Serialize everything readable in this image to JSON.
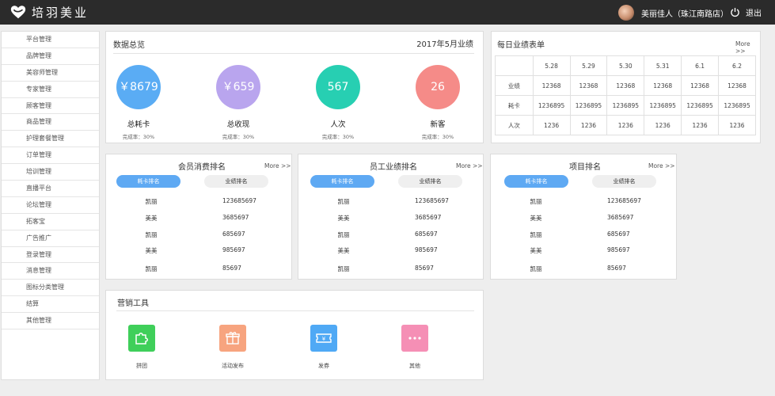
{
  "brand": {
    "name": "培羽美业"
  },
  "user": {
    "name": "美丽佳人（珠江南路店）",
    "logout_label": "退出"
  },
  "sidebar": {
    "items": [
      "平台管理",
      "品牌管理",
      "美容师管理",
      "专家管理",
      "顾客管理",
      "商品管理",
      "护理套餐管理",
      "订单管理",
      "培训管理",
      "直播平台",
      "论坛管理",
      "拓客宝",
      "广告推广",
      "登录管理",
      "消息管理",
      "图标分类管理",
      "结算",
      "其他管理"
    ]
  },
  "overview": {
    "title": "数据总览",
    "period": "2017年5月业绩",
    "stats": [
      {
        "value": "￥8679",
        "label": "总耗卡",
        "rate": "完成率：30%",
        "color": "#5aacf4"
      },
      {
        "value": "￥659",
        "label": "总收现",
        "rate": "完成率：30%",
        "color": "#b9a5ee"
      },
      {
        "value": "567",
        "label": "人次",
        "rate": "完成率：30%",
        "color": "#27cfb2"
      },
      {
        "value": "26",
        "label": "新客",
        "rate": "完成率：30%",
        "color": "#f58b88"
      }
    ]
  },
  "daily": {
    "title": "每日业绩表单",
    "more": "More >>",
    "dates": [
      "5.28",
      "5.29",
      "5.30",
      "5.31",
      "6.1",
      "6.2"
    ],
    "rows": [
      {
        "label": "业绩",
        "values": [
          "12368",
          "12368",
          "12368",
          "12368",
          "12368",
          "12368"
        ]
      },
      {
        "label": "耗卡",
        "values": [
          "1236895",
          "1236895",
          "1236895",
          "1236895",
          "1236895",
          "1236895"
        ]
      },
      {
        "label": "人次",
        "values": [
          "1236",
          "1236",
          "1236",
          "1236",
          "1236",
          "1236"
        ]
      }
    ]
  },
  "rankings": [
    {
      "title": "会员消费排名",
      "more": "More >>",
      "tab_active": "耗卡排名",
      "tab_inactive": "业绩排名",
      "rows": [
        [
          "凯丽",
          "123685697"
        ],
        [
          "美美",
          "3685697"
        ],
        [
          "凯丽",
          "685697"
        ],
        [
          "美美",
          "985697"
        ],
        [
          "凯丽",
          "85697"
        ]
      ]
    },
    {
      "title": "员工业绩排名",
      "more": "More >>",
      "tab_active": "耗卡排名",
      "tab_inactive": "业绩排名",
      "rows": [
        [
          "凯丽",
          "123685697"
        ],
        [
          "美美",
          "3685697"
        ],
        [
          "凯丽",
          "685697"
        ],
        [
          "美美",
          "985697"
        ],
        [
          "凯丽",
          "85697"
        ]
      ]
    },
    {
      "title": "项目排名",
      "more": "More >>",
      "tab_active": "耗卡排名",
      "tab_inactive": "业绩排名",
      "rows": [
        [
          "凯丽",
          "123685697"
        ],
        [
          "美美",
          "3685697"
        ],
        [
          "凯丽",
          "685697"
        ],
        [
          "美美",
          "985697"
        ],
        [
          "凯丽",
          "85697"
        ]
      ]
    }
  ],
  "marketing": {
    "title": "营销工具",
    "tools": [
      {
        "label": "拼团",
        "icon": "puzzle-icon",
        "color": "#3fcf5a"
      },
      {
        "label": "活动发布",
        "icon": "gift-icon",
        "color": "#f7a47f"
      },
      {
        "label": "发券",
        "icon": "ticket-icon",
        "color": "#4fa9f5"
      },
      {
        "label": "其他",
        "icon": "more-dots-icon",
        "color": "#f58fb5"
      }
    ]
  }
}
